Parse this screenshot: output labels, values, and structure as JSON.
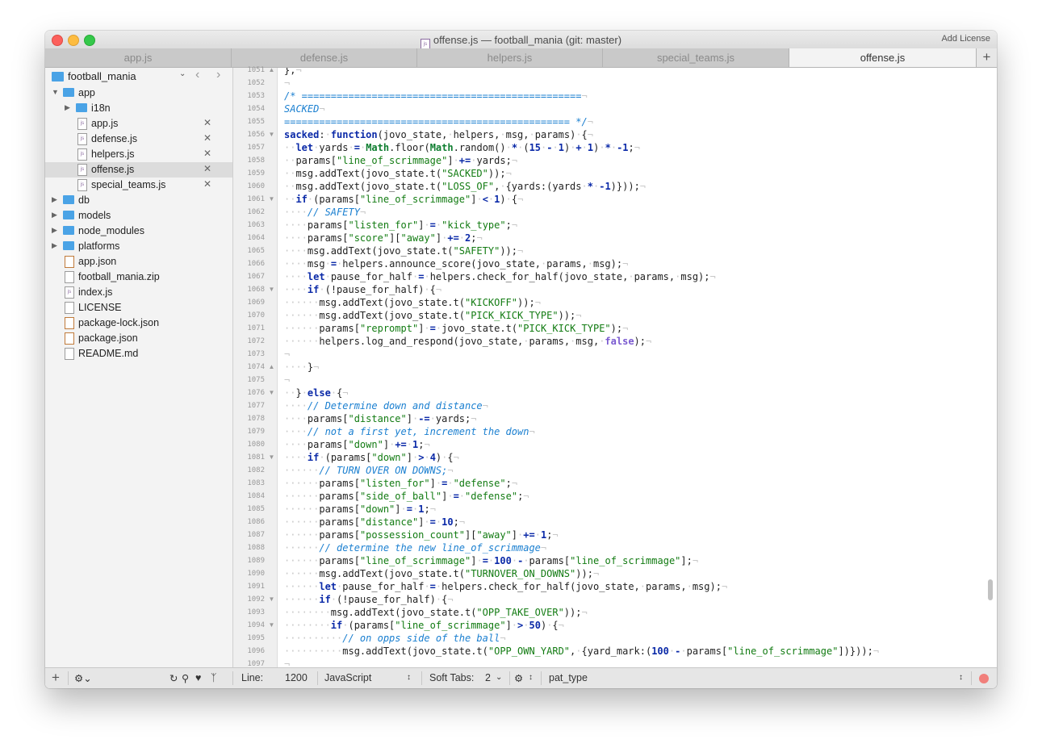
{
  "window": {
    "title": "offense.js — football_mania (git: master)",
    "add_license": "Add License",
    "file_badge": "js"
  },
  "tabs": [
    {
      "label": "app.js",
      "active": false
    },
    {
      "label": "defense.js",
      "active": false
    },
    {
      "label": "helpers.js",
      "active": false
    },
    {
      "label": "special_teams.js",
      "active": false
    },
    {
      "label": "offense.js",
      "active": true
    }
  ],
  "tab_add": "+",
  "sidebar": {
    "project": "football_mania",
    "items": [
      {
        "label": "app",
        "kind": "folder",
        "depth": 0,
        "expanded": true
      },
      {
        "label": "i18n",
        "kind": "folder",
        "depth": 1,
        "expanded": false
      },
      {
        "label": "app.js",
        "kind": "js",
        "depth": 1,
        "closable": true
      },
      {
        "label": "defense.js",
        "kind": "js",
        "depth": 1,
        "closable": true
      },
      {
        "label": "helpers.js",
        "kind": "js",
        "depth": 1,
        "closable": true
      },
      {
        "label": "offense.js",
        "kind": "js",
        "depth": 1,
        "closable": true,
        "selected": true
      },
      {
        "label": "special_teams.js",
        "kind": "js",
        "depth": 1,
        "closable": true
      },
      {
        "label": "db",
        "kind": "folder",
        "depth": 0,
        "expanded": false
      },
      {
        "label": "models",
        "kind": "folder",
        "depth": 0,
        "expanded": false
      },
      {
        "label": "node_modules",
        "kind": "folder",
        "depth": 0,
        "expanded": false
      },
      {
        "label": "platforms",
        "kind": "folder",
        "depth": 0,
        "expanded": false
      },
      {
        "label": "app.json",
        "kind": "json",
        "depth": 0
      },
      {
        "label": "football_mania.zip",
        "kind": "zip",
        "depth": 0
      },
      {
        "label": "index.js",
        "kind": "js",
        "depth": 0
      },
      {
        "label": "LICENSE",
        "kind": "file",
        "depth": 0
      },
      {
        "label": "package-lock.json",
        "kind": "json",
        "depth": 0
      },
      {
        "label": "package.json",
        "kind": "json",
        "depth": 0
      },
      {
        "label": "README.md",
        "kind": "file",
        "depth": 0
      }
    ]
  },
  "editor": {
    "lines": [
      {
        "n": "1051",
        "fold": "up",
        "t": "},"
      },
      {
        "n": "1052",
        "fold": "",
        "t": ""
      },
      {
        "n": "1053",
        "fold": "",
        "t": "/* ================================================"
      },
      {
        "n": "1054",
        "fold": "",
        "t": "SACKED"
      },
      {
        "n": "1055",
        "fold": "",
        "t": "================================================= */"
      },
      {
        "n": "1056",
        "fold": "down",
        "t": "sacked: function(jovo_state, helpers, msg, params) {"
      },
      {
        "n": "1057",
        "fold": "",
        "t": "  let yards = Math.floor(Math.random() * (15 - 1) + 1) * -1;"
      },
      {
        "n": "1058",
        "fold": "",
        "t": "  params[\"line_of_scrimmage\"] += yards;"
      },
      {
        "n": "1059",
        "fold": "",
        "t": "  msg.addText(jovo_state.t(\"SACKED\"));"
      },
      {
        "n": "1060",
        "fold": "",
        "t": "  msg.addText(jovo_state.t(\"LOSS_OF\", {yards:(yards * -1)}));"
      },
      {
        "n": "1061",
        "fold": "down",
        "t": "  if (params[\"line_of_scrimmage\"] < 1) {"
      },
      {
        "n": "1062",
        "fold": "",
        "t": "    // SAFETY"
      },
      {
        "n": "1063",
        "fold": "",
        "t": "    params[\"listen_for\"] = \"kick_type\";"
      },
      {
        "n": "1064",
        "fold": "",
        "t": "    params[\"score\"][\"away\"] += 2;"
      },
      {
        "n": "1065",
        "fold": "",
        "t": "    msg.addText(jovo_state.t(\"SAFETY\"));"
      },
      {
        "n": "1066",
        "fold": "",
        "t": "    msg = helpers.announce_score(jovo_state, params, msg);"
      },
      {
        "n": "1067",
        "fold": "",
        "t": "    let pause_for_half = helpers.check_for_half(jovo_state, params, msg);"
      },
      {
        "n": "1068",
        "fold": "down",
        "t": "    if (!pause_for_half) {"
      },
      {
        "n": "1069",
        "fold": "",
        "t": "      msg.addText(jovo_state.t(\"KICKOFF\"));"
      },
      {
        "n": "1070",
        "fold": "",
        "t": "      msg.addText(jovo_state.t(\"PICK_KICK_TYPE\"));"
      },
      {
        "n": "1071",
        "fold": "",
        "t": "      params[\"reprompt\"] = jovo_state.t(\"PICK_KICK_TYPE\");"
      },
      {
        "n": "1072",
        "fold": "",
        "t": "      helpers.log_and_respond(jovo_state, params, msg, false);"
      },
      {
        "n": "1073",
        "fold": "",
        "t": ""
      },
      {
        "n": "1074",
        "fold": "up",
        "t": "    }"
      },
      {
        "n": "1075",
        "fold": "",
        "t": ""
      },
      {
        "n": "1076",
        "fold": "down",
        "t": "  } else {"
      },
      {
        "n": "1077",
        "fold": "",
        "t": "    // Determine down and distance"
      },
      {
        "n": "1078",
        "fold": "",
        "t": "    params[\"distance\"] -= yards;"
      },
      {
        "n": "1079",
        "fold": "",
        "t": "    // not a first yet, increment the down"
      },
      {
        "n": "1080",
        "fold": "",
        "t": "    params[\"down\"] += 1;"
      },
      {
        "n": "1081",
        "fold": "down",
        "t": "    if (params[\"down\"] > 4) {"
      },
      {
        "n": "1082",
        "fold": "",
        "t": "      // TURN OVER ON DOWNS;"
      },
      {
        "n": "1083",
        "fold": "",
        "t": "      params[\"listen_for\"] = \"defense\";"
      },
      {
        "n": "1084",
        "fold": "",
        "t": "      params[\"side_of_ball\"] = \"defense\";"
      },
      {
        "n": "1085",
        "fold": "",
        "t": "      params[\"down\"] = 1;"
      },
      {
        "n": "1086",
        "fold": "",
        "t": "      params[\"distance\"] = 10;"
      },
      {
        "n": "1087",
        "fold": "",
        "t": "      params[\"possession_count\"][\"away\"] += 1;"
      },
      {
        "n": "1088",
        "fold": "",
        "t": "      // determine the new line_of_scrimmage"
      },
      {
        "n": "1089",
        "fold": "",
        "t": "      params[\"line_of_scrimmage\"] = 100 - params[\"line_of_scrimmage\"];"
      },
      {
        "n": "1090",
        "fold": "",
        "t": "      msg.addText(jovo_state.t(\"TURNOVER_ON_DOWNS\"));"
      },
      {
        "n": "1091",
        "fold": "",
        "t": "      let pause_for_half = helpers.check_for_half(jovo_state, params, msg);"
      },
      {
        "n": "1092",
        "fold": "down",
        "t": "      if (!pause_for_half) {"
      },
      {
        "n": "1093",
        "fold": "",
        "t": "        msg.addText(jovo_state.t(\"OPP_TAKE_OVER\"));"
      },
      {
        "n": "1094",
        "fold": "down",
        "t": "        if (params[\"line_of_scrimmage\"] > 50) {"
      },
      {
        "n": "1095",
        "fold": "",
        "t": "          // on opps side of the ball"
      },
      {
        "n": "1096",
        "fold": "",
        "t": "          msg.addText(jovo_state.t(\"OPP_OWN_YARD\", {yard_mark:(100 - params[\"line_of_scrimmage\"])}));"
      },
      {
        "n": "1097",
        "fold": "",
        "t": ""
      }
    ]
  },
  "statusbar": {
    "add": "+",
    "line_label": "Line:",
    "line_value": "1200",
    "language": "JavaScript",
    "tabs_label": "Soft Tabs:",
    "tabs_value": "2",
    "symbol": "pat_type"
  },
  "colors": {
    "keyword": "#0b2aa8",
    "string": "#127b12",
    "comment": "#1a7fd0",
    "number": "#0b2aa8",
    "builtin": "#0d7d2f",
    "bool": "#7a5ad0"
  }
}
